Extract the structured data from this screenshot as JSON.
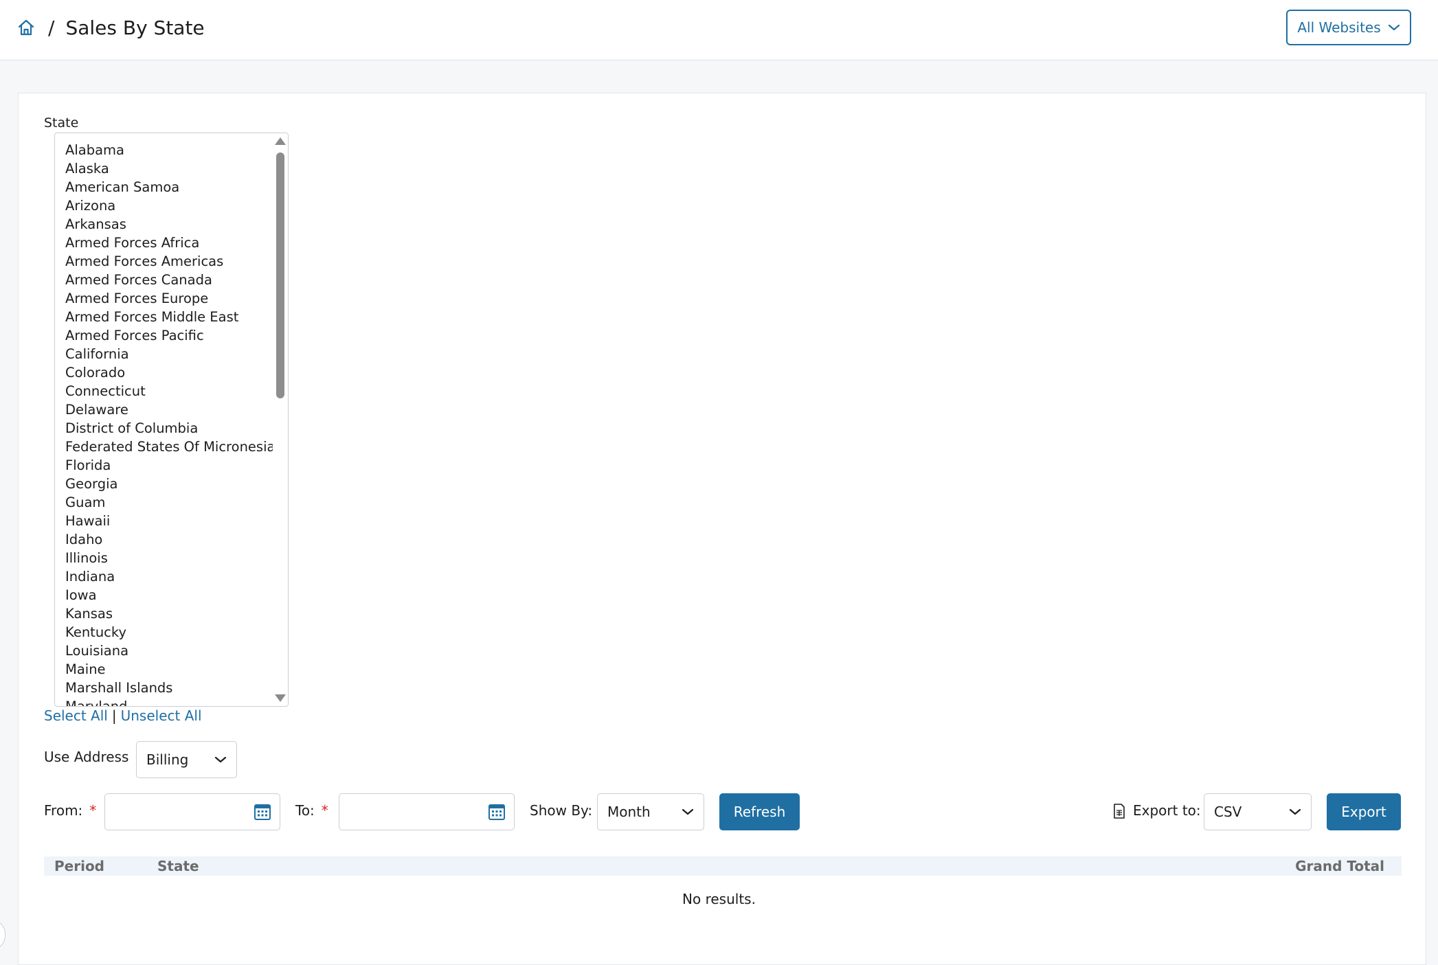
{
  "header": {
    "breadcrumb_separator": "/",
    "page_title": "Sales By State",
    "website_selector": "All Websites"
  },
  "filters": {
    "state_label": "State",
    "states": [
      "Alabama",
      "Alaska",
      "American Samoa",
      "Arizona",
      "Arkansas",
      "Armed Forces Africa",
      "Armed Forces Americas",
      "Armed Forces Canada",
      "Armed Forces Europe",
      "Armed Forces Middle East",
      "Armed Forces Pacific",
      "California",
      "Colorado",
      "Connecticut",
      "Delaware",
      "District of Columbia",
      "Federated States Of Micronesia",
      "Florida",
      "Georgia",
      "Guam",
      "Hawaii",
      "Idaho",
      "Illinois",
      "Indiana",
      "Iowa",
      "Kansas",
      "Kentucky",
      "Louisiana",
      "Maine",
      "Marshall Islands",
      "Maryland"
    ],
    "select_all": "Select All",
    "divider": "|",
    "unselect_all": "Unselect All",
    "use_address_label": "Use Address",
    "use_address_value": "Billing",
    "from_label": "From:",
    "to_label": "To:",
    "required_mark": "*",
    "from_value": "",
    "to_value": "",
    "show_by_label": "Show By:",
    "show_by_value": "Month",
    "refresh_label": "Refresh",
    "export_to_label": "Export to:",
    "export_format": "CSV",
    "export_label": "Export"
  },
  "table": {
    "columns": [
      "Period",
      "State",
      "Grand Total"
    ],
    "empty_message": "No results."
  },
  "colors": {
    "accent": "#1f6fa3",
    "required": "#d02b20",
    "table_header_bg": "#eef4fa"
  },
  "icons": {
    "home": "home-icon",
    "chevron": "chevron-down-icon",
    "calendar": "calendar-icon",
    "export": "document-icon"
  }
}
